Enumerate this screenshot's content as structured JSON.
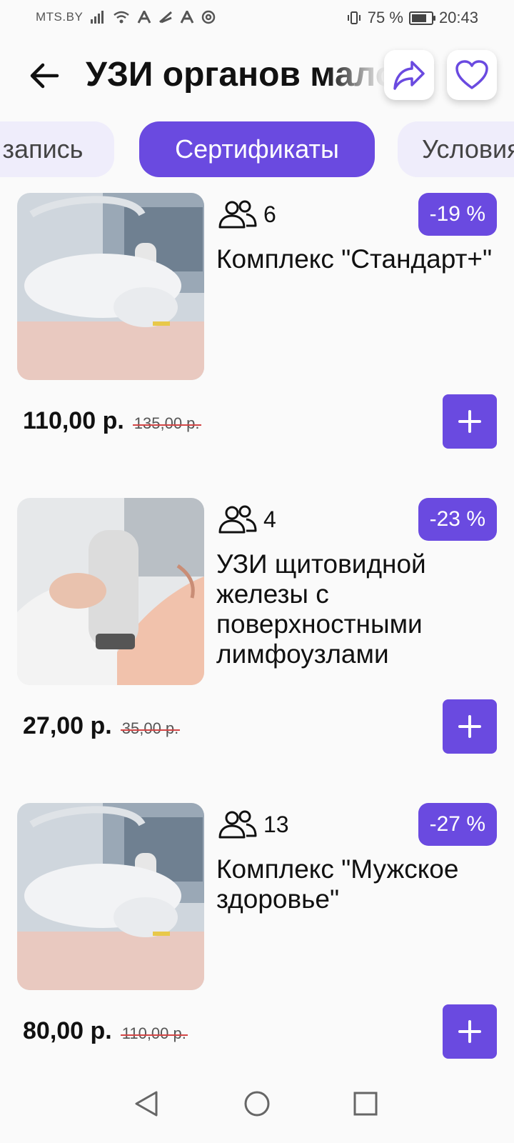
{
  "status_bar": {
    "carrier": "MTS.BY",
    "battery": "75 %",
    "time": "20:43",
    "icons": [
      "signal-icon",
      "wifi-icon",
      "a-icon",
      "share-status-icon",
      "a-icon",
      "at-icon",
      "vibrate-icon",
      "battery-icon"
    ]
  },
  "header": {
    "title": "УЗИ органов малого таза",
    "icons": [
      "back-arrow-icon",
      "share-icon",
      "heart-icon"
    ]
  },
  "tabs": [
    {
      "label": "запись"
    },
    {
      "label": "Сертификаты",
      "active": true
    },
    {
      "label": "Условия"
    }
  ],
  "cards": [
    {
      "people_count": "6",
      "discount": "-19 %",
      "title": "Комплекс \"Стандарт+\"",
      "price": "110,00 р.",
      "old_price": "135,00 р."
    },
    {
      "people_count": "4",
      "discount": "-23 %",
      "title": "УЗИ щитовидной железы с поверхностными лимфоузлами",
      "price": "27,00 р.",
      "old_price": "35,00 р."
    },
    {
      "people_count": "13",
      "discount": "-27 %",
      "title": "Комплекс \"Мужское здоровье\"",
      "price": "80,00 р.",
      "old_price": "110,00 р."
    }
  ],
  "colors": {
    "accent": "#6a4ae0",
    "tab_inactive_bg": "#efedfb",
    "background": "#fafafa",
    "strike": "#d24646"
  }
}
